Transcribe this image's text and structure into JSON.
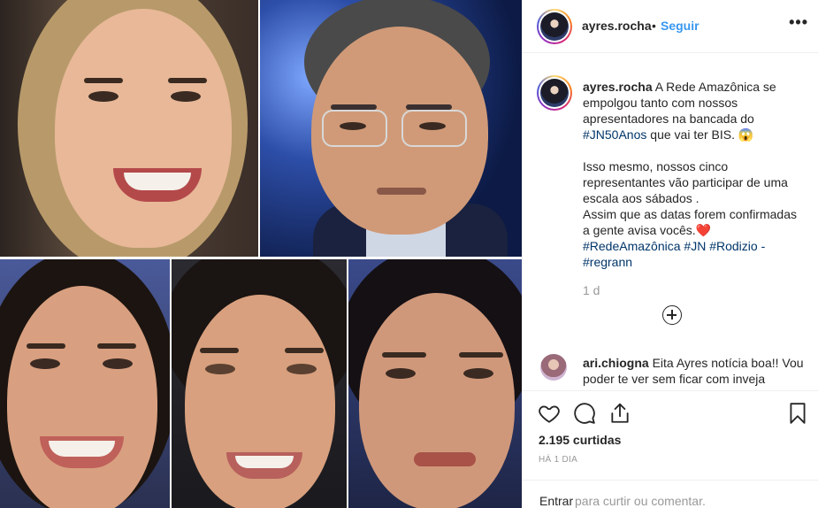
{
  "post": {
    "username": "ayres.rocha",
    "follow_label": "Seguir",
    "more_label": "•••",
    "separator": "•"
  },
  "caption": {
    "username": "ayres.rocha",
    "text_1": " A Rede Amazônica se empolgou tanto com nossos apresentadores na bancada do ",
    "tag_jn50": "#JN50Anos",
    "text_2": " que vai ter BIS. 😱",
    "para_2": "Isso mesmo, nossos cinco representantes vão participar de uma escala aos sábados .",
    "para_3": "Assim que as datas forem confirmadas a gente avisa vocês.",
    "heart": "❤️",
    "tag_rede": "#RedeAmazônica",
    "tag_jn": "#JN",
    "tag_rodizio": "#Rodizio",
    "dash": " -",
    "tag_regrann": "#regrann",
    "age": "1 d"
  },
  "comment": {
    "username": "ari.chiogna",
    "text": " Eita Ayres notícia boa!! Vou poder te ver sem ficar com inveja"
  },
  "footer": {
    "likes": "2.195 curtidas",
    "time_ago": "HÁ 1 DIA",
    "login_link": "Entrar",
    "login_rest": "para curtir ou comentar."
  },
  "icons": {
    "like": "heart-icon",
    "comment": "comment-icon",
    "share": "share-icon",
    "save": "bookmark-icon",
    "more": "more-icon",
    "load_more": "plus-circle-icon"
  },
  "colors": {
    "link_blue": "#3897f0",
    "hashtag": "#003569",
    "muted": "#999999",
    "text": "#262626"
  }
}
